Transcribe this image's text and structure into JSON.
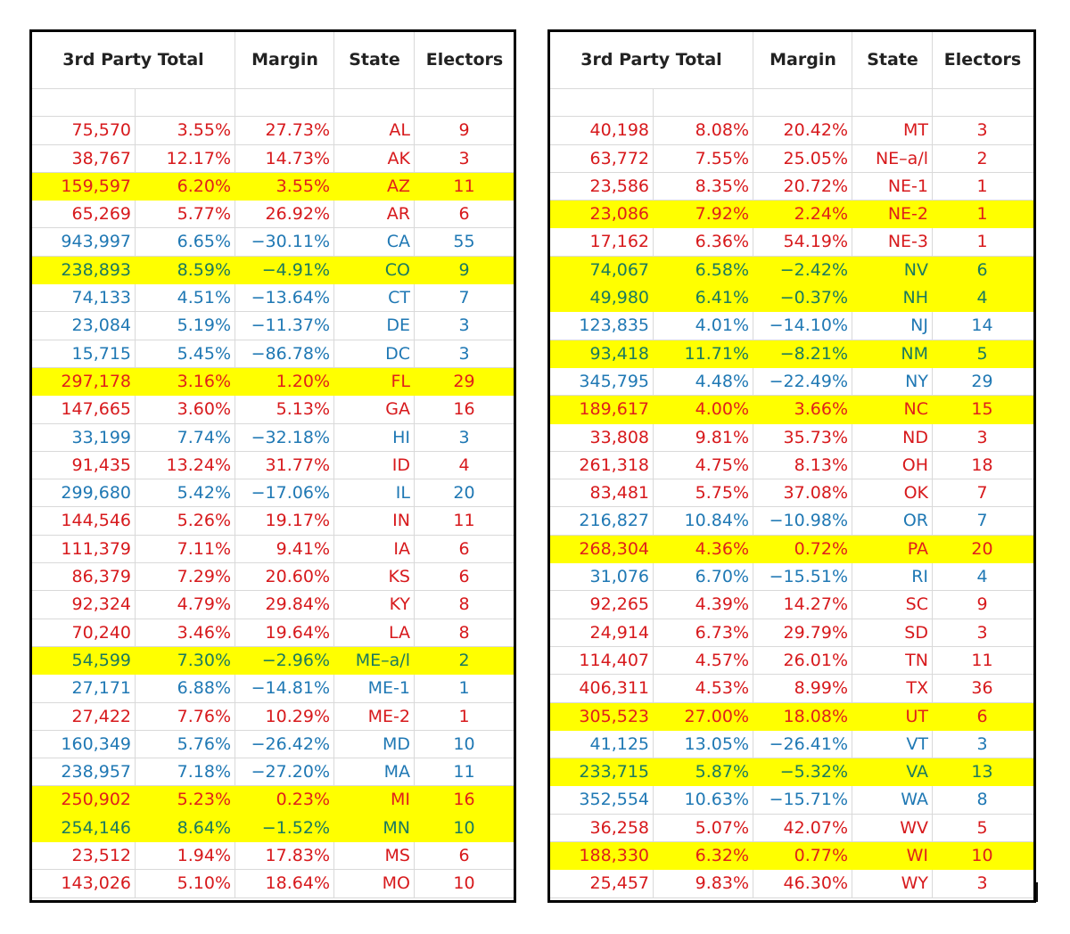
{
  "headers": {
    "third_party_total": "3rd Party Total",
    "margin": "Margin",
    "state": "State",
    "electors": "Electors"
  },
  "colors": {
    "rep": "#d7191c",
    "dem": "#1f78b4",
    "dem_on_highlight": "#1b7a5e",
    "highlight": "#ffff00"
  },
  "left_table": [
    {
      "votes": "75,570",
      "pct": "3.55%",
      "margin": "27.73%",
      "state": "AL",
      "electors": "9",
      "party": "red",
      "hl": false
    },
    {
      "votes": "38,767",
      "pct": "12.17%",
      "margin": "14.73%",
      "state": "AK",
      "electors": "3",
      "party": "red",
      "hl": false
    },
    {
      "votes": "159,597",
      "pct": "6.20%",
      "margin": "3.55%",
      "state": "AZ",
      "electors": "11",
      "party": "red",
      "hl": true
    },
    {
      "votes": "65,269",
      "pct": "5.77%",
      "margin": "26.92%",
      "state": "AR",
      "electors": "6",
      "party": "red",
      "hl": false
    },
    {
      "votes": "943,997",
      "pct": "6.65%",
      "margin": "−30.11%",
      "state": "CA",
      "electors": "55",
      "party": "blue",
      "hl": false
    },
    {
      "votes": "238,893",
      "pct": "8.59%",
      "margin": "−4.91%",
      "state": "CO",
      "electors": "9",
      "party": "blue",
      "hl": true
    },
    {
      "votes": "74,133",
      "pct": "4.51%",
      "margin": "−13.64%",
      "state": "CT",
      "electors": "7",
      "party": "blue",
      "hl": false
    },
    {
      "votes": "23,084",
      "pct": "5.19%",
      "margin": "−11.37%",
      "state": "DE",
      "electors": "3",
      "party": "blue",
      "hl": false
    },
    {
      "votes": "15,715",
      "pct": "5.45%",
      "margin": "−86.78%",
      "state": "DC",
      "electors": "3",
      "party": "blue",
      "hl": false
    },
    {
      "votes": "297,178",
      "pct": "3.16%",
      "margin": "1.20%",
      "state": "FL",
      "electors": "29",
      "party": "red",
      "hl": true
    },
    {
      "votes": "147,665",
      "pct": "3.60%",
      "margin": "5.13%",
      "state": "GA",
      "electors": "16",
      "party": "red",
      "hl": false
    },
    {
      "votes": "33,199",
      "pct": "7.74%",
      "margin": "−32.18%",
      "state": "HI",
      "electors": "3",
      "party": "blue",
      "hl": false
    },
    {
      "votes": "91,435",
      "pct": "13.24%",
      "margin": "31.77%",
      "state": "ID",
      "electors": "4",
      "party": "red",
      "hl": false
    },
    {
      "votes": "299,680",
      "pct": "5.42%",
      "margin": "−17.06%",
      "state": "IL",
      "electors": "20",
      "party": "blue",
      "hl": false
    },
    {
      "votes": "144,546",
      "pct": "5.26%",
      "margin": "19.17%",
      "state": "IN",
      "electors": "11",
      "party": "red",
      "hl": false
    },
    {
      "votes": "111,379",
      "pct": "7.11%",
      "margin": "9.41%",
      "state": "IA",
      "electors": "6",
      "party": "red",
      "hl": false
    },
    {
      "votes": "86,379",
      "pct": "7.29%",
      "margin": "20.60%",
      "state": "KS",
      "electors": "6",
      "party": "red",
      "hl": false
    },
    {
      "votes": "92,324",
      "pct": "4.79%",
      "margin": "29.84%",
      "state": "KY",
      "electors": "8",
      "party": "red",
      "hl": false
    },
    {
      "votes": "70,240",
      "pct": "3.46%",
      "margin": "19.64%",
      "state": "LA",
      "electors": "8",
      "party": "red",
      "hl": false
    },
    {
      "votes": "54,599",
      "pct": "7.30%",
      "margin": "−2.96%",
      "state": "ME–a/l",
      "electors": "2",
      "party": "blue",
      "hl": true
    },
    {
      "votes": "27,171",
      "pct": "6.88%",
      "margin": "−14.81%",
      "state": "ME-1",
      "electors": "1",
      "party": "blue",
      "hl": false
    },
    {
      "votes": "27,422",
      "pct": "7.76%",
      "margin": "10.29%",
      "state": "ME-2",
      "electors": "1",
      "party": "red",
      "hl": false
    },
    {
      "votes": "160,349",
      "pct": "5.76%",
      "margin": "−26.42%",
      "state": "MD",
      "electors": "10",
      "party": "blue",
      "hl": false
    },
    {
      "votes": "238,957",
      "pct": "7.18%",
      "margin": "−27.20%",
      "state": "MA",
      "electors": "11",
      "party": "blue",
      "hl": false
    },
    {
      "votes": "250,902",
      "pct": "5.23%",
      "margin": "0.23%",
      "state": "MI",
      "electors": "16",
      "party": "red",
      "hl": true
    },
    {
      "votes": "254,146",
      "pct": "8.64%",
      "margin": "−1.52%",
      "state": "MN",
      "electors": "10",
      "party": "blue",
      "hl": true
    },
    {
      "votes": "23,512",
      "pct": "1.94%",
      "margin": "17.83%",
      "state": "MS",
      "electors": "6",
      "party": "red",
      "hl": false
    },
    {
      "votes": "143,026",
      "pct": "5.10%",
      "margin": "18.64%",
      "state": "MO",
      "electors": "10",
      "party": "red",
      "hl": false
    }
  ],
  "right_table": [
    {
      "votes": "40,198",
      "pct": "8.08%",
      "margin": "20.42%",
      "state": "MT",
      "electors": "3",
      "party": "red",
      "hl": false
    },
    {
      "votes": "63,772",
      "pct": "7.55%",
      "margin": "25.05%",
      "state": "NE–a/l",
      "electors": "2",
      "party": "red",
      "hl": false
    },
    {
      "votes": "23,586",
      "pct": "8.35%",
      "margin": "20.72%",
      "state": "NE-1",
      "electors": "1",
      "party": "red",
      "hl": false
    },
    {
      "votes": "23,086",
      "pct": "7.92%",
      "margin": "2.24%",
      "state": "NE-2",
      "electors": "1",
      "party": "red",
      "hl": true
    },
    {
      "votes": "17,162",
      "pct": "6.36%",
      "margin": "54.19%",
      "state": "NE-3",
      "electors": "1",
      "party": "red",
      "hl": false
    },
    {
      "votes": "74,067",
      "pct": "6.58%",
      "margin": "−2.42%",
      "state": "NV",
      "electors": "6",
      "party": "blue",
      "hl": true
    },
    {
      "votes": "49,980",
      "pct": "6.41%",
      "margin": "−0.37%",
      "state": "NH",
      "electors": "4",
      "party": "blue",
      "hl": true
    },
    {
      "votes": "123,835",
      "pct": "4.01%",
      "margin": "−14.10%",
      "state": "NJ",
      "electors": "14",
      "party": "blue",
      "hl": false
    },
    {
      "votes": "93,418",
      "pct": "11.71%",
      "margin": "−8.21%",
      "state": "NM",
      "electors": "5",
      "party": "blue",
      "hl": true
    },
    {
      "votes": "345,795",
      "pct": "4.48%",
      "margin": "−22.49%",
      "state": "NY",
      "electors": "29",
      "party": "blue",
      "hl": false
    },
    {
      "votes": "189,617",
      "pct": "4.00%",
      "margin": "3.66%",
      "state": "NC",
      "electors": "15",
      "party": "red",
      "hl": true
    },
    {
      "votes": "33,808",
      "pct": "9.81%",
      "margin": "35.73%",
      "state": "ND",
      "electors": "3",
      "party": "red",
      "hl": false
    },
    {
      "votes": "261,318",
      "pct": "4.75%",
      "margin": "8.13%",
      "state": "OH",
      "electors": "18",
      "party": "red",
      "hl": false
    },
    {
      "votes": "83,481",
      "pct": "5.75%",
      "margin": "37.08%",
      "state": "OK",
      "electors": "7",
      "party": "red",
      "hl": false
    },
    {
      "votes": "216,827",
      "pct": "10.84%",
      "margin": "−10.98%",
      "state": "OR",
      "electors": "7",
      "party": "blue",
      "hl": false
    },
    {
      "votes": "268,304",
      "pct": "4.36%",
      "margin": "0.72%",
      "state": "PA",
      "electors": "20",
      "party": "red",
      "hl": true
    },
    {
      "votes": "31,076",
      "pct": "6.70%",
      "margin": "−15.51%",
      "state": "RI",
      "electors": "4",
      "party": "blue",
      "hl": false
    },
    {
      "votes": "92,265",
      "pct": "4.39%",
      "margin": "14.27%",
      "state": "SC",
      "electors": "9",
      "party": "red",
      "hl": false
    },
    {
      "votes": "24,914",
      "pct": "6.73%",
      "margin": "29.79%",
      "state": "SD",
      "electors": "3",
      "party": "red",
      "hl": false
    },
    {
      "votes": "114,407",
      "pct": "4.57%",
      "margin": "26.01%",
      "state": "TN",
      "electors": "11",
      "party": "red",
      "hl": false
    },
    {
      "votes": "406,311",
      "pct": "4.53%",
      "margin": "8.99%",
      "state": "TX",
      "electors": "36",
      "party": "red",
      "hl": false
    },
    {
      "votes": "305,523",
      "pct": "27.00%",
      "margin": "18.08%",
      "state": "UT",
      "electors": "6",
      "party": "red",
      "hl": true
    },
    {
      "votes": "41,125",
      "pct": "13.05%",
      "margin": "−26.41%",
      "state": "VT",
      "electors": "3",
      "party": "blue",
      "hl": false
    },
    {
      "votes": "233,715",
      "pct": "5.87%",
      "margin": "−5.32%",
      "state": "VA",
      "electors": "13",
      "party": "blue",
      "hl": true
    },
    {
      "votes": "352,554",
      "pct": "10.63%",
      "margin": "−15.71%",
      "state": "WA",
      "electors": "8",
      "party": "blue",
      "hl": false
    },
    {
      "votes": "36,258",
      "pct": "5.07%",
      "margin": "42.07%",
      "state": "WV",
      "electors": "5",
      "party": "red",
      "hl": false
    },
    {
      "votes": "188,330",
      "pct": "6.32%",
      "margin": "0.77%",
      "state": "WI",
      "electors": "10",
      "party": "red",
      "hl": true
    },
    {
      "votes": "25,457",
      "pct": "9.83%",
      "margin": "46.30%",
      "state": "WY",
      "electors": "3",
      "party": "red",
      "hl": false
    }
  ]
}
